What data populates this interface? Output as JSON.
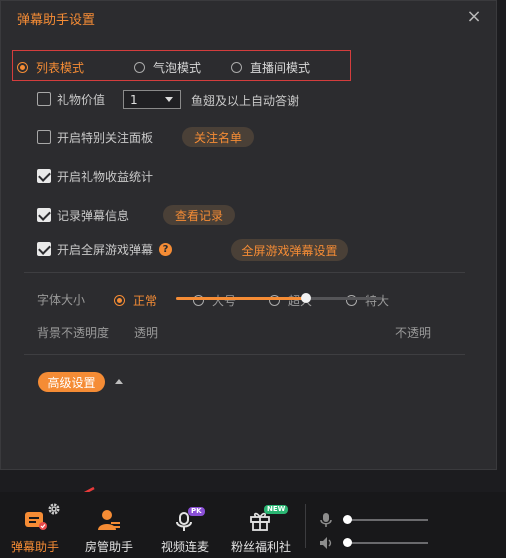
{
  "dialog": {
    "title": "弹幕助手设置",
    "close_symbol": "×"
  },
  "display_mode": {
    "options": [
      {
        "label": "列表模式",
        "selected": true
      },
      {
        "label": "气泡模式",
        "selected": false
      },
      {
        "label": "直播间模式",
        "selected": false
      }
    ]
  },
  "gift_value": {
    "label": "礼物价值",
    "checked": false,
    "selected_value": "1",
    "suffix": "鱼翅及以上自动答谢"
  },
  "special_follow": {
    "label": "开启特别关注面板",
    "checked": false,
    "button_label": "关注名单"
  },
  "gift_income": {
    "label": "开启礼物收益统计",
    "checked": true
  },
  "record_danmaku": {
    "label": "记录弹幕信息",
    "checked": true,
    "button_label": "查看记录"
  },
  "fullscreen_game": {
    "label": "开启全屏游戏弹幕",
    "checked": true,
    "help_symbol": "?",
    "button_label": "全屏游戏弹幕设置"
  },
  "font_size": {
    "label": "字体大小",
    "options": [
      {
        "label": "正常",
        "selected": true
      },
      {
        "label": "大号",
        "selected": false
      },
      {
        "label": "超大",
        "selected": false
      },
      {
        "label": "特大",
        "selected": false
      }
    ]
  },
  "bg_opacity": {
    "label": "背景不透明度",
    "min_label": "透明",
    "max_label": "不透明",
    "value_fraction": 0.63
  },
  "advanced": {
    "button_label": "高级设置"
  },
  "bottom_toolbar": {
    "items": [
      {
        "label": "弹幕助手",
        "active": true
      },
      {
        "label": "房管助手",
        "active": false
      },
      {
        "label": "视频连麦",
        "active": false,
        "badge": "PK"
      },
      {
        "label": "粉丝福利社",
        "active": false,
        "badge": "NEW"
      }
    ],
    "mic_volume_fraction": 0.0,
    "speaker_volume_fraction": 0.0
  },
  "colors": {
    "accent": "#f58c35",
    "highlight_border": "#d43d3d",
    "background": "#2c2c2f"
  }
}
